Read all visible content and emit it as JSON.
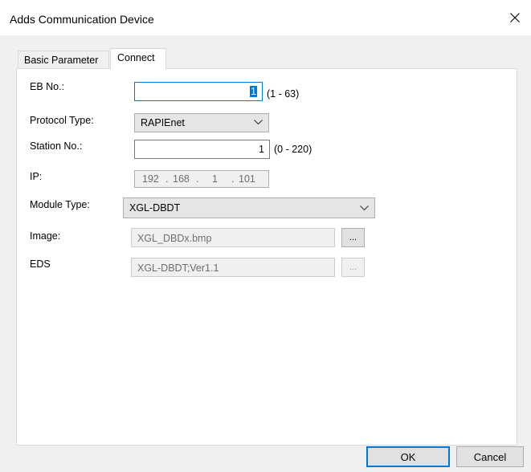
{
  "window": {
    "title": "Adds Communication Device"
  },
  "tabs": [
    {
      "label": "Basic Parameter",
      "active": false
    },
    {
      "label": "Connect",
      "active": true
    }
  ],
  "form": {
    "eb_no": {
      "label": "EB No.:",
      "value": "1",
      "hint": "(1 - 63)"
    },
    "protocol_type": {
      "label": "Protocol Type:",
      "value": "RAPIEnet"
    },
    "station_no": {
      "label": "Station No.:",
      "value": "1",
      "hint": "(0 - 220)"
    },
    "ip": {
      "label": "IP:",
      "octets": [
        "192",
        "168",
        "1",
        "101"
      ],
      "dot": "."
    },
    "module_type": {
      "label": "Module Type:",
      "value": "XGL-DBDT"
    },
    "image": {
      "label": "Image:",
      "value": "XGL_DBDx.bmp",
      "browse_label": "..."
    },
    "eds": {
      "label": "EDS",
      "value": "XGL-DBDT;Ver1.1",
      "browse_label": "..."
    }
  },
  "buttons": {
    "ok": "OK",
    "cancel": "Cancel"
  },
  "icons": {
    "close": "close-icon",
    "dropdown": "chevron-down-icon"
  },
  "colors": {
    "accent": "#0078d7",
    "window_bg": "#f0f0f0",
    "panel_bg": "#ffffff"
  }
}
